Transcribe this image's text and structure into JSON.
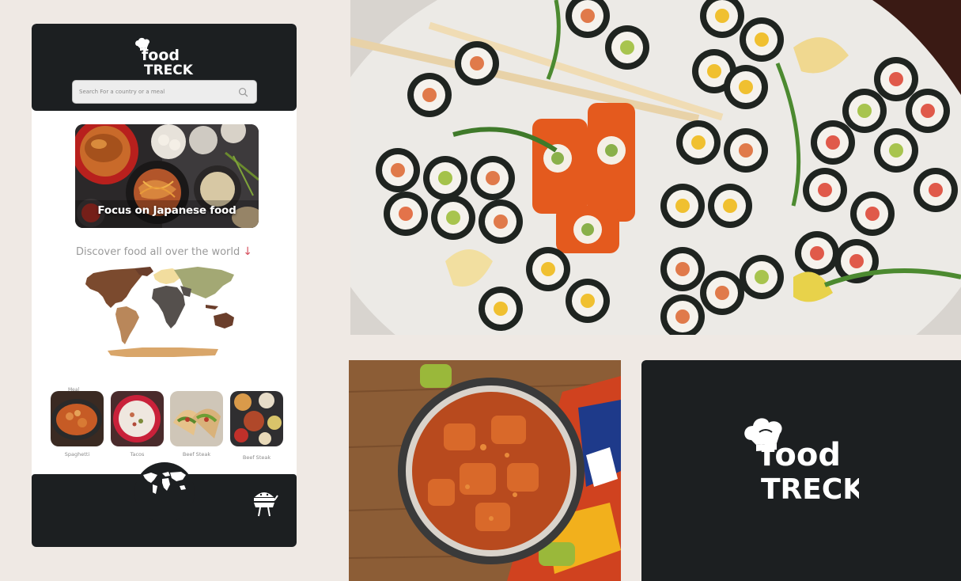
{
  "brand": {
    "line1": "food",
    "line2": "TRECK"
  },
  "search": {
    "placeholder": "Search For a country or a meal"
  },
  "hero": {
    "title": "Focus on Japanese food"
  },
  "discover": {
    "text": "Discover food all over the world",
    "arrow": "↓"
  },
  "meal_caption": "Meal",
  "meals": [
    {
      "label": "Spaghetti"
    },
    {
      "label": "Tacos"
    },
    {
      "label": "Beef Steak"
    },
    {
      "label": "Beef Steak"
    }
  ],
  "colors": {
    "dark": "#1c1f21",
    "background": "#efe9e4",
    "accent_arrow": "#d6505e",
    "map_north_america": "#7b4a2e",
    "map_south_america": "#b9875a",
    "map_europe": "#f2dd9e",
    "map_africa": "#55504d",
    "map_asia": "#a3a874",
    "map_oceania": "#6a3e2b",
    "map_antarctica": "#d9a66a"
  },
  "icons": [
    "search-icon",
    "globe-icon",
    "burger-mascot-icon",
    "chef-hat-icon",
    "down-arrow-icon"
  ]
}
